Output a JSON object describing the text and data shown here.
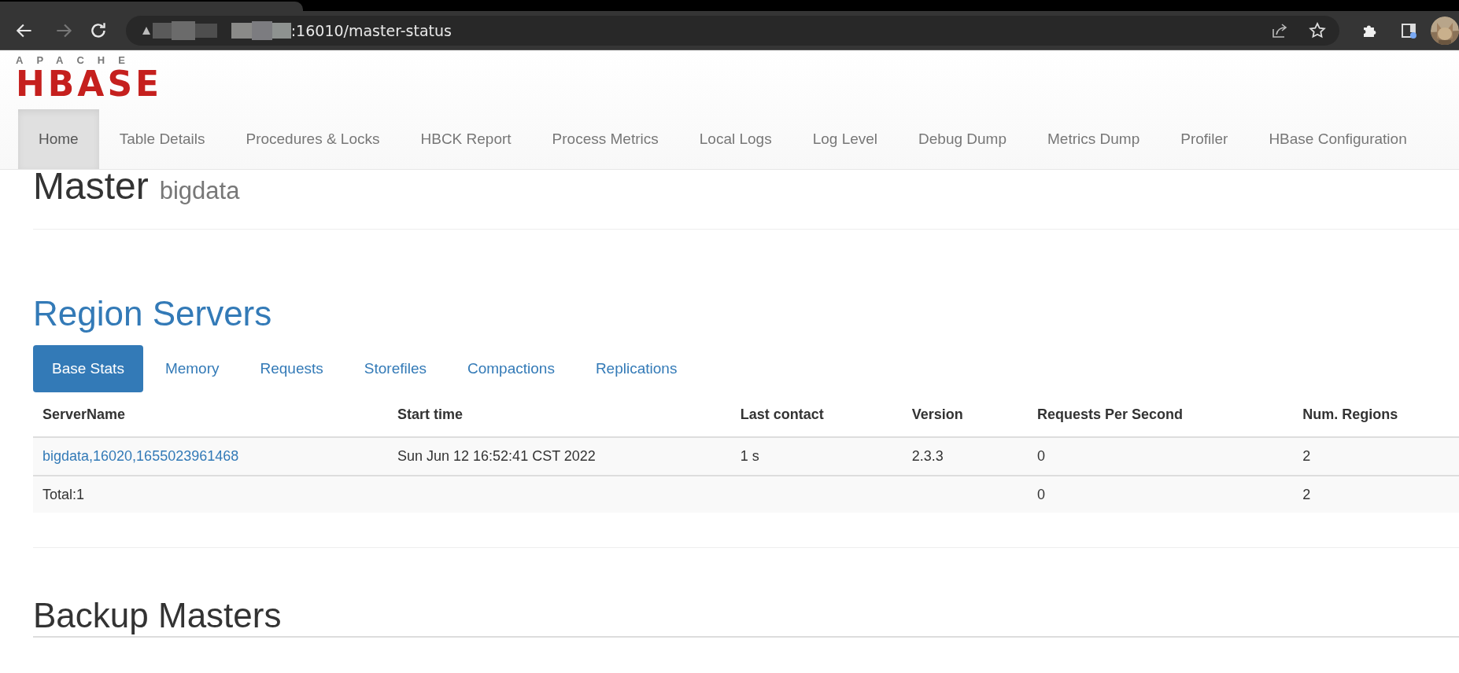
{
  "browser": {
    "back_enabled": true,
    "forward_enabled": false,
    "address": ":16010/master-status"
  },
  "logo": {
    "top": "APACHE",
    "main": "HBASE"
  },
  "navbar": {
    "items": [
      {
        "label": "Home",
        "selected": true
      },
      {
        "label": "Table Details",
        "selected": false
      },
      {
        "label": "Procedures & Locks",
        "selected": false
      },
      {
        "label": "HBCK Report",
        "selected": false
      },
      {
        "label": "Process Metrics",
        "selected": false
      },
      {
        "label": "Local Logs",
        "selected": false
      },
      {
        "label": "Log Level",
        "selected": false
      },
      {
        "label": "Debug Dump",
        "selected": false
      },
      {
        "label": "Metrics Dump",
        "selected": false
      },
      {
        "label": "Profiler",
        "selected": false
      },
      {
        "label": "HBase Configuration",
        "selected": false
      }
    ]
  },
  "heading": {
    "title": "Master",
    "subtitle": "bigdata"
  },
  "region_servers": {
    "title": "Region Servers",
    "tabs": [
      {
        "label": "Base Stats",
        "selected": true
      },
      {
        "label": "Memory",
        "selected": false
      },
      {
        "label": "Requests",
        "selected": false
      },
      {
        "label": "Storefiles",
        "selected": false
      },
      {
        "label": "Compactions",
        "selected": false
      },
      {
        "label": "Replications",
        "selected": false
      }
    ],
    "table": {
      "columns": [
        "ServerName",
        "Start time",
        "Last contact",
        "Version",
        "Requests Per Second",
        "Num. Regions"
      ],
      "rows": [
        {
          "kind": "server",
          "cells": [
            "bigdata,16020,1655023961468",
            "Sun Jun 12 16:52:41 CST 2022",
            "1 s",
            "2.3.3",
            "0",
            "2"
          ]
        },
        {
          "kind": "total",
          "cells": [
            "Total:1",
            "",
            "",
            "",
            "0",
            "2"
          ]
        }
      ]
    }
  },
  "backup_masters": {
    "title": "Backup Masters"
  }
}
